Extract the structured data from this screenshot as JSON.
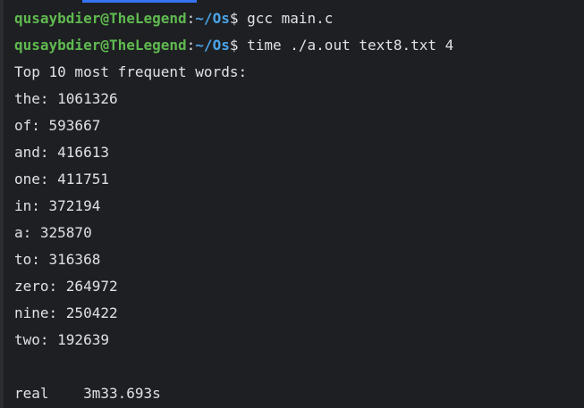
{
  "prompt": {
    "user_host": "qusaybdier@TheLegend",
    "path": "~/Os",
    "symbol": "$"
  },
  "commands": [
    "gcc main.c",
    "time ./a.out text8.txt 4"
  ],
  "output": {
    "header": "Top 10 most frequent words:",
    "words": [
      "the: 1061326",
      "of: 593667",
      "and: 416613",
      "one: 411751",
      "in: 372194",
      "a: 325870",
      "to: 316368",
      "zero: 264972",
      "nine: 250422",
      "two: 192639"
    ],
    "timing": "real    3m33.693s"
  }
}
